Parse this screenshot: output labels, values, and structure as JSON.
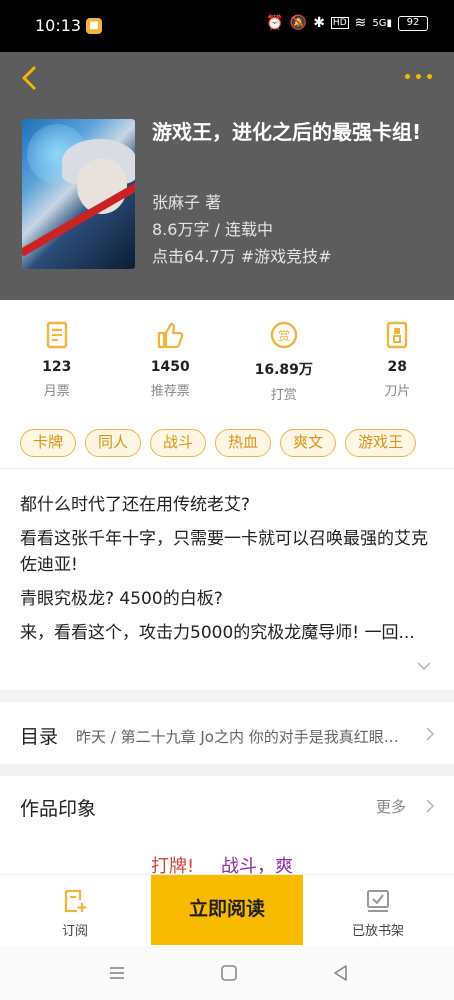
{
  "status_bar": {
    "time": "10:13",
    "battery": "92",
    "signal": "5G"
  },
  "book": {
    "title": "游戏王，进化之后的最强卡组!",
    "author": "张麻子  著",
    "words_status": "8.6万字 / 连载中",
    "clicks_category": "点击64.7万  #游戏竞技#"
  },
  "stats": [
    {
      "value": "123",
      "label": "月票",
      "icon": "monthly-ticket-icon"
    },
    {
      "value": "1450",
      "label": "推荐票",
      "icon": "thumbs-up-icon"
    },
    {
      "value": "16.89万",
      "label": "打赏",
      "icon": "reward-coin-icon"
    },
    {
      "value": "28",
      "label": "刀片",
      "icon": "blade-icon"
    }
  ],
  "tags": [
    "卡牌",
    "同人",
    "战斗",
    "热血",
    "爽文",
    "游戏王"
  ],
  "description": [
    "都什么时代了还在用传统老艾?",
    "看看这张千年十字，只需要一卡就可以召唤最强的艾克佐迪亚!",
    "青眼究极龙? 4500的白板?",
    "来，看看这个，攻击力5000的究极龙魔导师! 一回..."
  ],
  "toc": {
    "label": "目录",
    "latest": "昨天 / 第二十九章 Jo之内 你的对手是我真红眼黑龙"
  },
  "impressions": {
    "label": "作品印象",
    "more": "更多",
    "words": [
      "打牌!",
      "战斗，爽"
    ]
  },
  "actions": {
    "subscribe": "订阅",
    "read_now": "立即阅读",
    "on_shelf": "已放书架"
  },
  "colors": {
    "accent": "#f8bb00",
    "header_bg": "#5d5d5d",
    "tag_border": "#f2b53c"
  }
}
